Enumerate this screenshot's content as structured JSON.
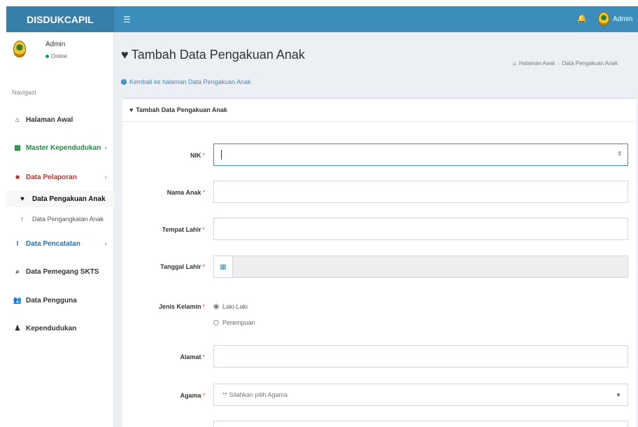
{
  "header": {
    "brand": "DISDUKCAPIL",
    "menu_icon": "☰",
    "bell_icon": "bell-icon",
    "user": "Admin"
  },
  "sidebar": {
    "user_name": "Admin",
    "status": "Online",
    "nav_header": "Navigasi",
    "items": [
      {
        "label": "Halaman Awal",
        "icon": "home-icon"
      },
      {
        "label": "Master Kependudukan",
        "icon": "grid-icon"
      },
      {
        "label": "Data Pelaporan",
        "icon": "book-icon"
      },
      {
        "label": "Data Pengakuan Anak",
        "icon": "heart-icon"
      },
      {
        "label": "Data Pengangkatan Anak",
        "icon": "arrow-up-icon"
      },
      {
        "label": "Data Pencatatan",
        "icon": "text-cursor-icon"
      },
      {
        "label": "Data Pemegang SKTS",
        "icon": "search-icon"
      },
      {
        "label": "Data Pengguna",
        "icon": "users-icon"
      },
      {
        "label": "Kependudukan",
        "icon": "person-icon"
      }
    ]
  },
  "page": {
    "title": "Tambah Data Pengakuan Anak",
    "back_link": "Kembali ke halaman Data Pengakuan Anak",
    "breadcrumb": [
      "Halaman Awal",
      "Data Pengakuan Anak"
    ],
    "box_title": "Tambah Data Pengakuan Anak"
  },
  "form": {
    "nik_label": "NIK",
    "nama_label": "Nama Anak",
    "tempat_label": "Tempat Lahir",
    "tanggal_label": "Tanggal Lahir",
    "jk_label": "Jenis Kelamin",
    "jk_options": [
      "Laki-Laki",
      "Perempuan"
    ],
    "jk_selected": "Laki-Laki",
    "alamat_label": "Alamat",
    "agama_label": "Agama",
    "agama_placeholder": "** Silahkan pilih Agama"
  },
  "colors": {
    "header": "#3c8dbc",
    "brand": "#367fa9",
    "required": "#dd4b39"
  }
}
